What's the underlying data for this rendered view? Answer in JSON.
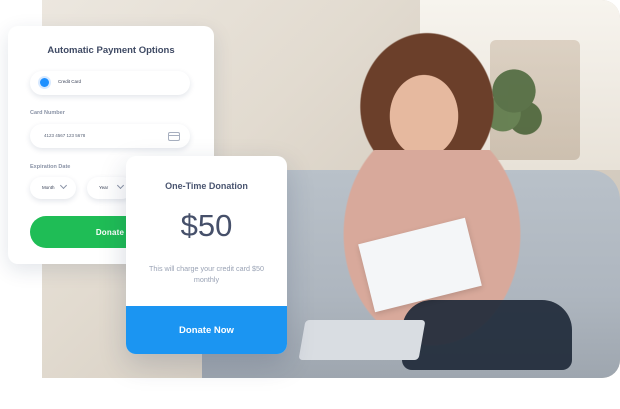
{
  "payment_card": {
    "title": "Automatic Payment Options",
    "radio_option": "Credit Card",
    "card_number_label": "Card Number",
    "card_number_value": "4123 4567 123 5678",
    "expiration_label": "Expiration Date",
    "month_select": "Month",
    "year_select": "Year",
    "donate_button": "Donate"
  },
  "donation_card": {
    "title": "One-Time Donation",
    "amount": "$50",
    "charge_note": "This will charge your credit card $50 monthly",
    "donate_now_button": "Donate Now"
  },
  "colors": {
    "green_button": "#1fbd56",
    "blue_button": "#1b95f2",
    "radio_selected": "#1e90ff",
    "title_text": "#3f4a64"
  },
  "icons": {
    "card": "credit-card-icon",
    "chevron": "chevron-down-icon"
  }
}
